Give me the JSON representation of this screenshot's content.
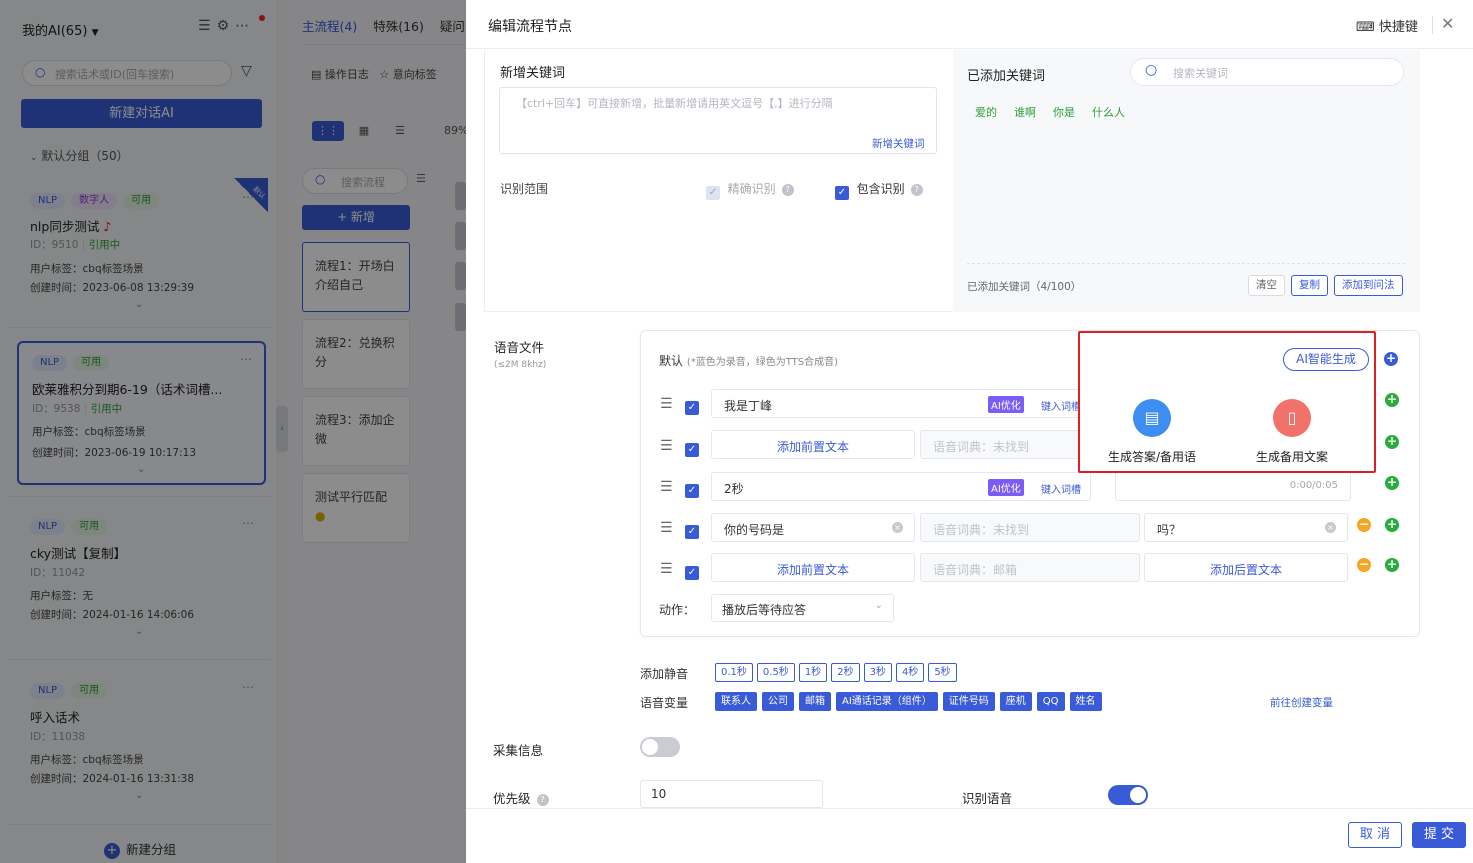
{
  "sidebar": {
    "title": "我的AI(65)",
    "search_placeholder": "搜索话术或ID(回车搜索)",
    "new_button": "新建对话AI",
    "group": "默认分组（50）",
    "default_ribbon": "默认",
    "cards": [
      {
        "tags": [
          "NLP",
          "数字人",
          "可用"
        ],
        "name": "nlp同步测试",
        "id": "ID：9510",
        "ref": "引用中",
        "label": "用户标签：cbq标签场景",
        "created": "创建时间：2023-06-08 13:29:39"
      },
      {
        "tags": [
          "NLP",
          "可用"
        ],
        "name": "欧莱雅积分到期6-19（话术词槽...",
        "id": "ID：9538",
        "ref": "引用中",
        "label": "用户标签：cbq标签场景",
        "created": "创建时间：2023-06-19 10:17:13"
      },
      {
        "tags": [
          "NLP",
          "可用"
        ],
        "name": "cky测试【复制】",
        "id": "ID：11042",
        "ref": "",
        "label": "用户标签：无",
        "created": "创建时间：2024-01-16 14:06:06"
      },
      {
        "tags": [
          "NLP",
          "可用"
        ],
        "name": "呼入话术",
        "id": "ID：11038",
        "ref": "",
        "label": "用户标签：cbq标签场景",
        "created": "创建时间：2024-01-16 13:31:38"
      }
    ],
    "new_group": "新建分组"
  },
  "middle": {
    "tabs": [
      "主流程(4)",
      "特殊(16)",
      "疑问"
    ],
    "toolbar": [
      "操作日志",
      "意向标签"
    ],
    "zoom": "89%",
    "search_placeholder": "搜索流程",
    "add_button": "+ 新增",
    "flows": [
      "流程1：开场白介绍自己",
      "流程2：兑换积分",
      "流程3：添加企微",
      "测试平行匹配"
    ]
  },
  "drawer": {
    "title": "编辑流程节点",
    "shortcut": "快捷键",
    "keywords": {
      "new_title": "新增关键词",
      "textarea_placeholder": "【ctrl+回车】可直接新增，批量新增请用英文逗号【,】进行分隔",
      "add_link": "新增关键词",
      "scope_label": "识别范围",
      "exact": "精确识别",
      "include": "包含识别",
      "added_title": "已添加关键词",
      "search_placeholder": "搜索关键词",
      "tags": [
        "爱的",
        "谁啊",
        "你是",
        "什么人"
      ],
      "count": "已添加关键词（4/100）",
      "clear": "清空",
      "copy": "复制",
      "add_to_q": "添加到问法"
    },
    "voice": {
      "label": "语音文件",
      "sub": "(≤2M 8khz)",
      "default": "默认",
      "hint": "(*蓝色为录音，绿色为TTS合成音)",
      "ai_badge": "AI优化",
      "dict_link": "键入词槽",
      "rows": [
        {
          "text": "我是丁峰",
          "dict": "",
          "post": ""
        },
        {
          "text": "添加前置文本",
          "dict": "语音词典：未找到",
          "post": ""
        },
        {
          "text": "2秒",
          "dict": "",
          "post": "0:00/0:05"
        },
        {
          "text": "你的号码是",
          "dict": "语音词典：未找到",
          "post": "吗？"
        },
        {
          "text": "添加前置文本",
          "dict": "语音词典：邮箱",
          "post": "添加后置文本"
        }
      ],
      "action_label": "动作：",
      "action_value": "播放后等待应答"
    },
    "silence": {
      "label": "添加静音",
      "options": [
        "0.1秒",
        "0.5秒",
        "1秒",
        "2秒",
        "3秒",
        "4秒",
        "5秒"
      ]
    },
    "variables": {
      "label": "语音变量",
      "items": [
        "联系人",
        "公司",
        "邮箱",
        "AI通话记录（组件）",
        "证件号码",
        "座机",
        "QQ",
        "姓名"
      ],
      "create_link": "前往创建变量"
    },
    "collect_label": "采集信息",
    "priority_label": "优先级",
    "priority_value": "10",
    "recognize_label": "识别语音",
    "cancel": "取 消",
    "submit": "提 交"
  },
  "popover": {
    "ai_button": "AI智能生成",
    "item1": "生成答案/备用语",
    "item2": "生成备用文案"
  },
  "colors": {
    "primary": "#3a5bd7",
    "green": "#27ae3a",
    "orange": "#f5a623",
    "highlight": "#e02020"
  }
}
